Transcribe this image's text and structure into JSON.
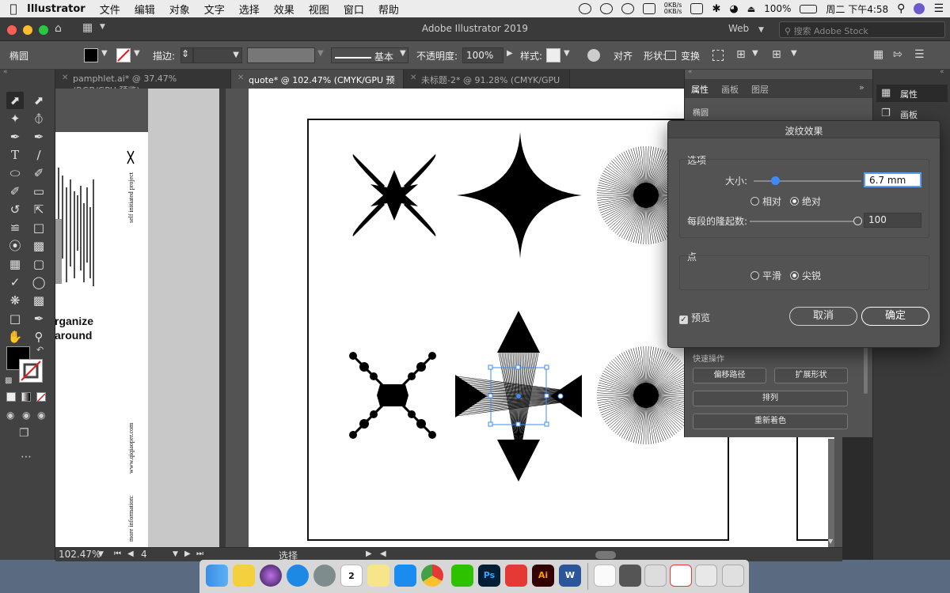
{
  "menubar": {
    "app_name": "Illustrator",
    "items": [
      "文件",
      "编辑",
      "对象",
      "文字",
      "选择",
      "效果",
      "视图",
      "窗口",
      "帮助"
    ],
    "net_up": "0KB/s",
    "net_down": "0KB/s",
    "battery": "100%",
    "datetime": "周二 下午4:58"
  },
  "titlebar": {
    "title": "Adobe Illustrator 2019",
    "workspace": "Web",
    "stock_placeholder": "搜索 Adobe Stock"
  },
  "control": {
    "object_type": "椭圆",
    "stroke_label": "描边:",
    "brush_label": "基本",
    "opacity_label": "不透明度:",
    "opacity_value": "100%",
    "style_label": "样式:",
    "align_label": "对齐",
    "shape_label": "形状:",
    "transform_label": "变换"
  },
  "tabs": [
    {
      "label": "pamphlet.ai* @ 37.47% (RGB/GPU 预览)"
    },
    {
      "label": "quote* @ 102.47% (CMYK/GPU 预览)"
    },
    {
      "label": "未标题-2* @ 91.28% (CMYK/GPU 预览)"
    }
  ],
  "left_doc": {
    "vertical_top": "self initiated project",
    "vertical_url": "www.qiqiaoper.com",
    "vertical_info": "more information:",
    "text_line1": "rganize",
    "text_line2": "around"
  },
  "status": {
    "zoom": "102.47%",
    "page": "4",
    "tool": "选择"
  },
  "panel": {
    "tabs": [
      "属性",
      "画板",
      "图层"
    ],
    "object_label": "椭圆",
    "quick_actions_label": "快速操作",
    "buttons": [
      "偏移路径",
      "扩展形状",
      "排列",
      "重新着色"
    ]
  },
  "right_strip": {
    "items": [
      "属性",
      "画板"
    ]
  },
  "dialog": {
    "title": "波纹效果",
    "options_label": "选项",
    "size_label": "大小:",
    "size_value": "6.7 mm",
    "size_fraction": 0.2,
    "relative_label": "相对",
    "absolute_label": "绝对",
    "absolute_selected": true,
    "ridges_label": "每段的隆起数:",
    "ridges_value": "100",
    "ridges_fraction": 1.0,
    "points_label": "点",
    "smooth_label": "平滑",
    "corner_label": "尖锐",
    "corner_selected": true,
    "preview_label": "预览",
    "preview_checked": true,
    "cancel_label": "取消",
    "ok_label": "确定"
  },
  "dock": {
    "calendar_day": "2",
    "apps": [
      "finder",
      "notes",
      "siri",
      "safari",
      "launchpad",
      "calendar",
      "stickies",
      "app-store",
      "chrome",
      "wechat",
      "photoshop",
      "youdao",
      "illustrator",
      "word",
      "preview",
      "trash"
    ]
  },
  "colors": {
    "accent": "#3d8bf7",
    "panel_bg": "#535353",
    "dark_bg": "#2b2b2b"
  }
}
